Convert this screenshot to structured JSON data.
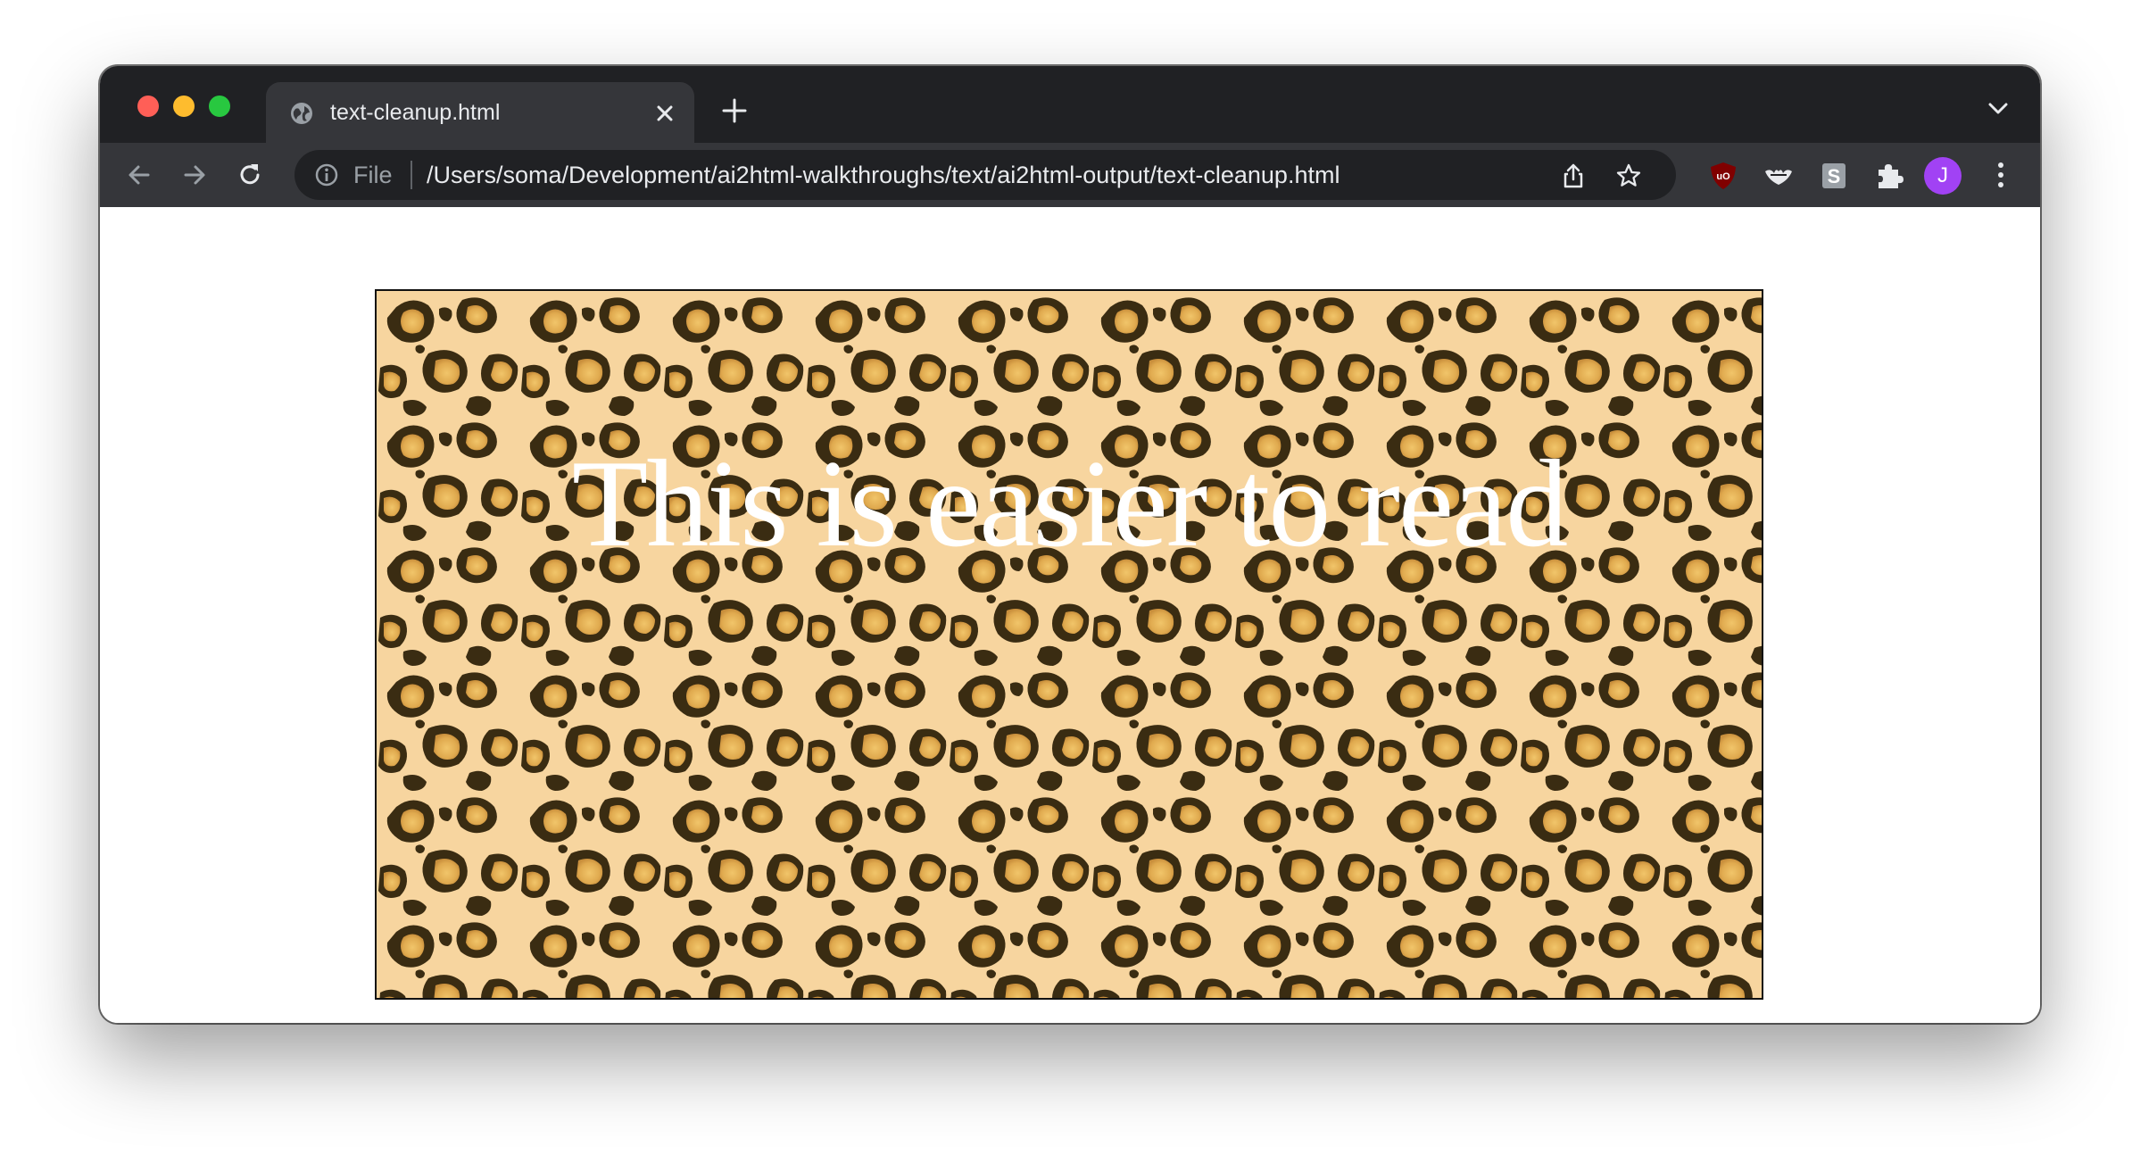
{
  "browser": {
    "tab": {
      "title": "text-cleanup.html",
      "favicon": "globe-icon"
    },
    "omnibox": {
      "scheme_label": "File",
      "url": "/Users/soma/Development/ai2html-walkthroughs/text/ai2html-output/text-cleanup.html"
    },
    "profile_initial": "J",
    "colors": {
      "titlebar": "#202124",
      "toolbar": "#35363a",
      "omnibox": "#202124",
      "avatar": "#a142f4"
    }
  },
  "page": {
    "headline": "This is easier to read",
    "background_pattern": "leopard-print",
    "colors": {
      "pattern_base": "#f7d59f",
      "pattern_rosette": "#3a2c12",
      "pattern_center": "#e8b35a",
      "headline": "#ffffff"
    }
  }
}
